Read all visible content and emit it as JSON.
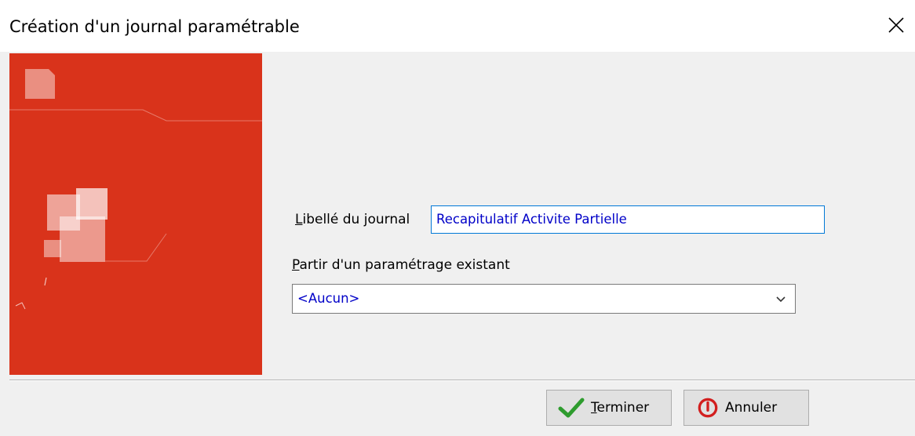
{
  "window": {
    "title": "Création d'un journal paramétrable"
  },
  "form": {
    "libelle_label_key": "L",
    "libelle_label_rest": "ibellé du journal",
    "libelle_value": "Recapitulatif Activite Partielle",
    "partir_label_key": "P",
    "partir_label_rest": "artir d'un paramétrage existant",
    "partir_selected": "<Aucun>"
  },
  "buttons": {
    "terminer_key": "T",
    "terminer_rest": "erminer",
    "annuler": "Annuler"
  },
  "colors": {
    "banner": "#d9331b",
    "input_text": "#0000c8",
    "check": "#2e9c2e",
    "cancel": "#d21f1f"
  }
}
